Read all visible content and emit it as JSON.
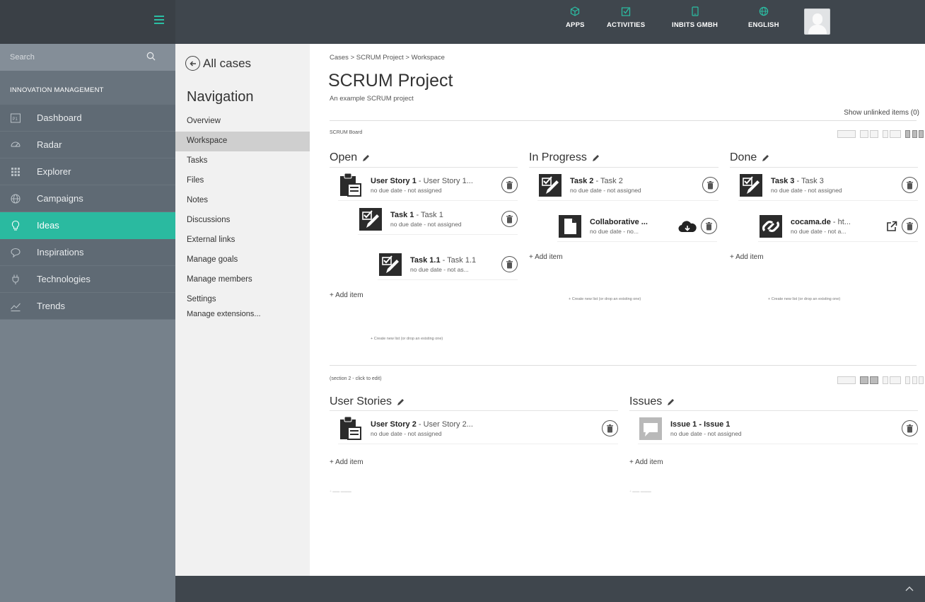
{
  "topbar": {
    "nav": [
      {
        "label": "APPS",
        "icon": "cube-icon"
      },
      {
        "label": "ACTIVITIES",
        "icon": "checkbox-icon"
      },
      {
        "label": "INBITS GMBH",
        "icon": "tablet-icon"
      },
      {
        "label": "ENGLISH",
        "icon": "globe-icon"
      }
    ],
    "accent": "#2bbfa4"
  },
  "sidebar": {
    "search_placeholder": "Search",
    "section_title": "INNOVATION MANAGEMENT",
    "items": [
      {
        "label": "Dashboard",
        "icon": "dashboard-icon"
      },
      {
        "label": "Radar",
        "icon": "radar-icon"
      },
      {
        "label": "Explorer",
        "icon": "grid-icon"
      },
      {
        "label": "Campaigns",
        "icon": "globe-icon"
      },
      {
        "label": "Ideas",
        "icon": "lightbulb-icon",
        "active": true
      },
      {
        "label": "Inspirations",
        "icon": "chat-bubble-icon"
      },
      {
        "label": "Technologies",
        "icon": "plug-icon"
      },
      {
        "label": "Trends",
        "icon": "trend-icon"
      }
    ],
    "active_color": "#2abaa0"
  },
  "navcol": {
    "back_label": "All cases",
    "heading": "Navigation",
    "links": [
      "Overview",
      "Workspace",
      "Tasks",
      "Files",
      "Notes",
      "Discussions",
      "External links",
      "Manage goals",
      "Manage members",
      "Settings",
      "Manage extensions..."
    ],
    "active": "Workspace"
  },
  "main": {
    "breadcrumb": "Cases > SCRUM Project > Workspace",
    "title": "SCRUM Project",
    "subtitle": "An example SCRUM project",
    "show_unlinked": "Show unlinked items (0)",
    "add_item": "+ Add item",
    "create_list": "+ Create new list (or drop an existing one)",
    "section1": {
      "label": "SCRUM Board",
      "columns": [
        {
          "title": "Open",
          "cards": [
            {
              "title": "User Story 1",
              "rest": " - User Story 1...",
              "meta": "no due date - not assigned",
              "icon": "user-story-icon"
            },
            {
              "title": "Task 1",
              "rest": " - Task 1",
              "meta": "no due date - not assigned",
              "icon": "task-icon"
            },
            {
              "title": "Task 1.1",
              "rest": " - Task 1.1",
              "meta": "no due date - not as...",
              "icon": "task-icon"
            }
          ]
        },
        {
          "title": "In Progress",
          "cards": [
            {
              "title": "Task 2",
              "rest": " - Task 2",
              "meta": "no due date - not assigned",
              "icon": "task-icon"
            },
            {
              "title": "Collaborative ...",
              "rest": "",
              "meta": "no due date - no...",
              "icon": "document-icon",
              "extra": "cloud-download-icon"
            }
          ]
        },
        {
          "title": "Done",
          "cards": [
            {
              "title": "Task 3",
              "rest": " - Task 3",
              "meta": "no due date - not assigned",
              "icon": "task-icon"
            },
            {
              "title": "cocama.de",
              "rest": " - ht...",
              "meta": "no due date - not a...",
              "icon": "link-icon",
              "extra": "external-link-icon"
            }
          ]
        }
      ]
    },
    "section2": {
      "label": "(section 2 - click to edit)",
      "columns": [
        {
          "title": "User Stories",
          "cards": [
            {
              "title": "User Story 2",
              "rest": " - User Story 2...",
              "meta": "no due date - not assigned",
              "icon": "user-story-icon"
            }
          ]
        },
        {
          "title": "Issues",
          "cards": [
            {
              "title": "Issue 1",
              "rest": " - Issue 1",
              "meta": "no due date - not assigned",
              "icon": "issue-icon"
            }
          ]
        }
      ]
    }
  }
}
